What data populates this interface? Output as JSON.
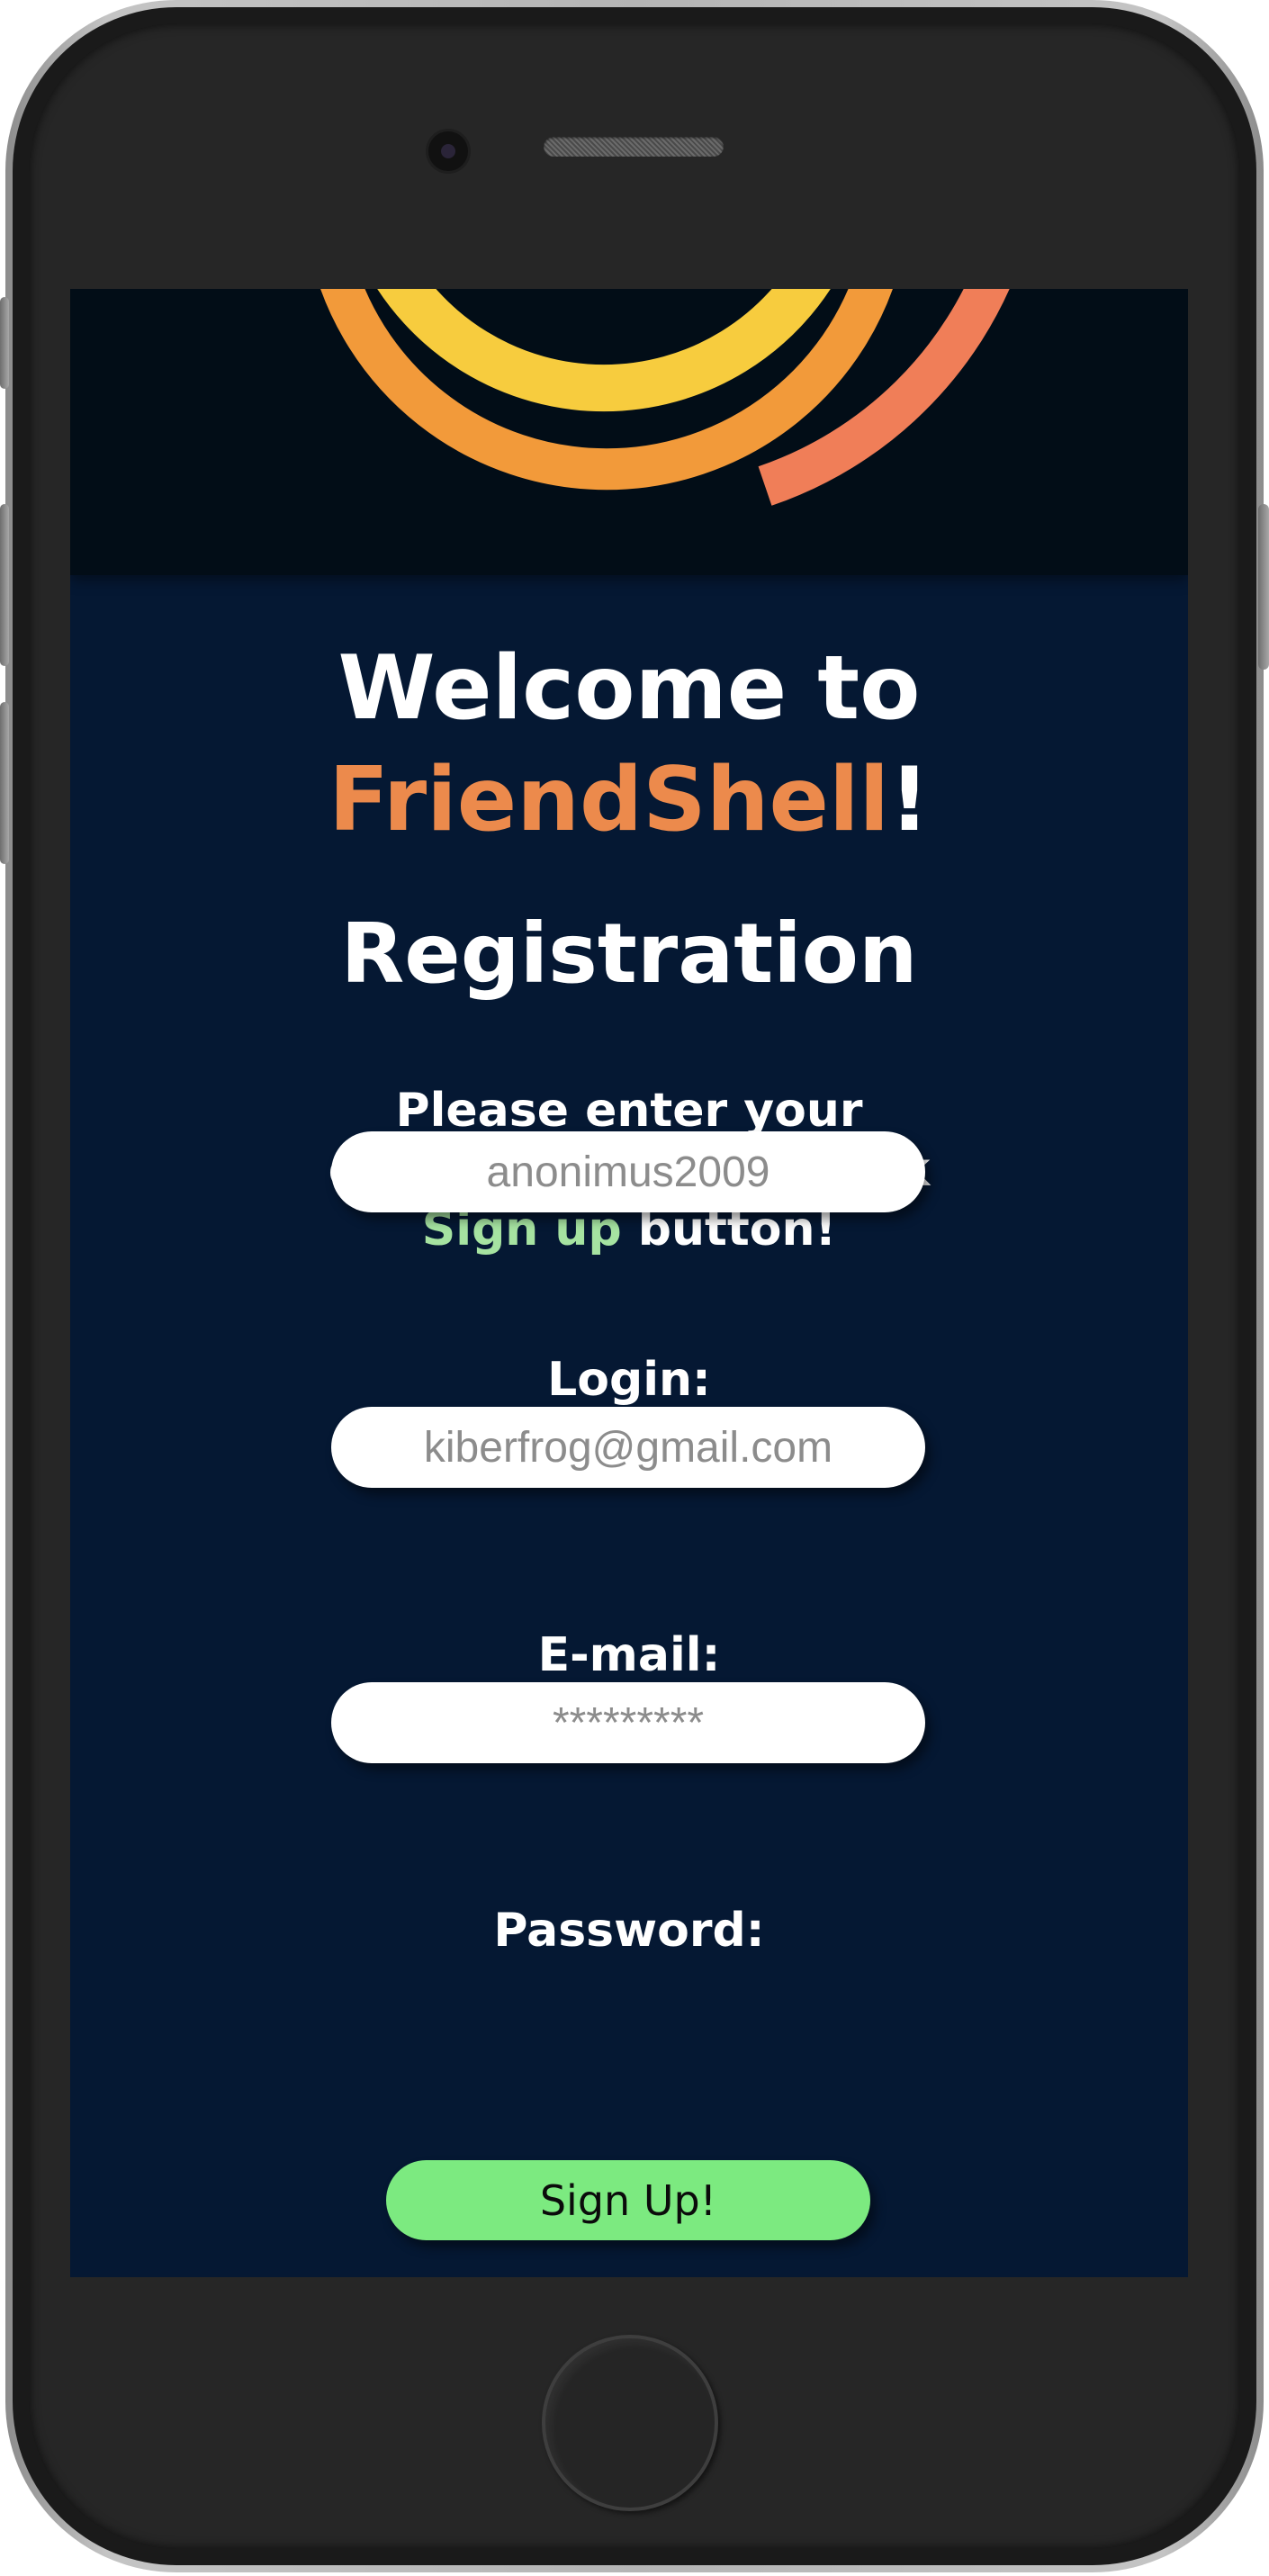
{
  "colors": {
    "background": "#051833",
    "brand": "#ec8a4c",
    "link": "#a6e3a1",
    "button": "#7cea80",
    "logo_yellow": "#f7cc3e",
    "logo_orange": "#f29a3a",
    "logo_coral": "#f07e58"
  },
  "header": {
    "welcome_prefix": "Welcome to",
    "brand_name": "FriendShell",
    "welcome_suffix": "!"
  },
  "page_title": "Registration",
  "instructions": {
    "before": "Please enter your details below and click ",
    "highlight": "Sign up",
    "after": " button!"
  },
  "form": {
    "login": {
      "label": "Login:",
      "placeholder": "anonimus2009"
    },
    "email": {
      "label": "E-mail:",
      "placeholder": "kiberfrog@gmail.com"
    },
    "password": {
      "label": "Password:",
      "placeholder": "*********"
    },
    "submit_label": "Sign Up!"
  }
}
